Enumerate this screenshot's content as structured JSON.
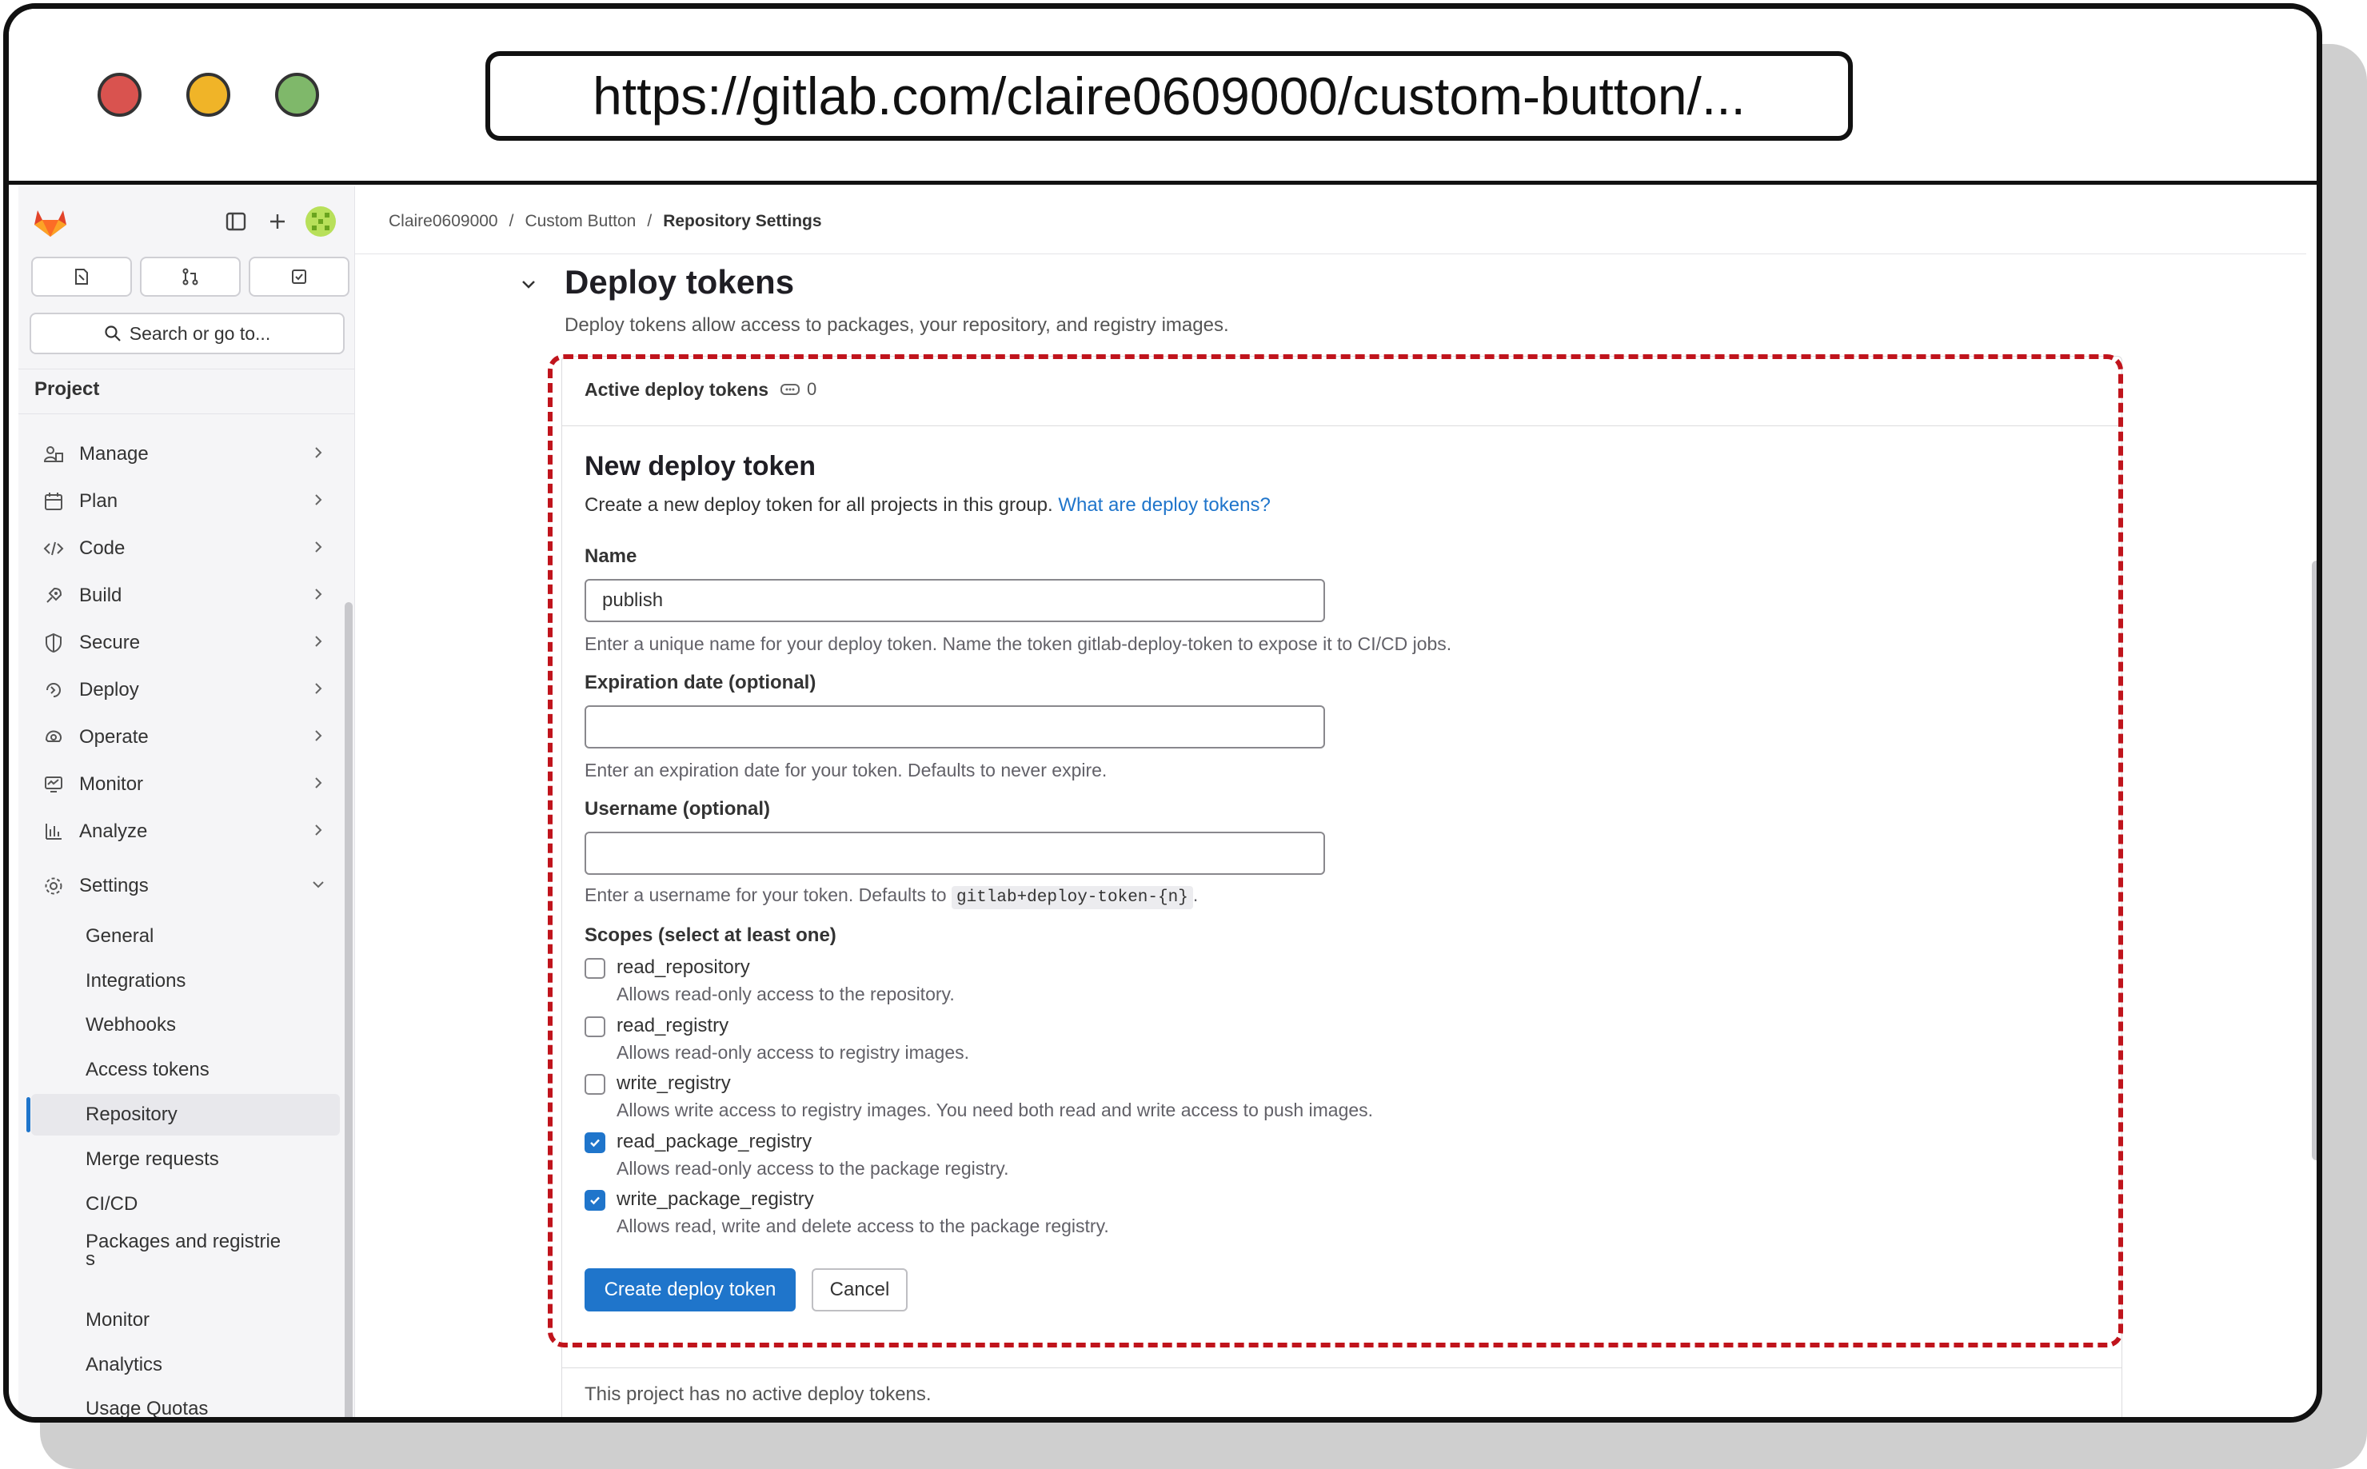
{
  "browser": {
    "url": "https://gitlab.com/claire0609000/custom-button/...",
    "dots": [
      "#d9534f",
      "#f0b428",
      "#7fb86a"
    ]
  },
  "sidebar": {
    "search_label": "Search or go to...",
    "section_label": "Project",
    "nav": [
      {
        "label": "Manage",
        "icon": "manage-icon"
      },
      {
        "label": "Plan",
        "icon": "plan-icon"
      },
      {
        "label": "Code",
        "icon": "code-icon"
      },
      {
        "label": "Build",
        "icon": "build-icon"
      },
      {
        "label": "Secure",
        "icon": "shield-icon"
      },
      {
        "label": "Deploy",
        "icon": "deploy-icon"
      },
      {
        "label": "Operate",
        "icon": "operate-icon"
      },
      {
        "label": "Monitor",
        "icon": "monitor-icon"
      },
      {
        "label": "Analyze",
        "icon": "analyze-icon"
      },
      {
        "label": "Settings",
        "icon": "gear-icon"
      }
    ],
    "settings_sub": [
      {
        "label": "General"
      },
      {
        "label": "Integrations"
      },
      {
        "label": "Webhooks"
      },
      {
        "label": "Access tokens"
      },
      {
        "label": "Repository",
        "active": true
      },
      {
        "label": "Merge requests"
      },
      {
        "label": "CI/CD"
      },
      {
        "label": "Packages and registrie\ns"
      },
      {
        "label": "Monitor"
      },
      {
        "label": "Analytics"
      },
      {
        "label": "Usage Quotas"
      }
    ]
  },
  "breadcrumb": {
    "items": [
      "Claire0609000",
      "Custom Button",
      "Repository Settings"
    ],
    "separator": "/"
  },
  "section": {
    "title": "Deploy tokens",
    "description": "Deploy tokens allow access to packages, your repository, and registry images."
  },
  "card": {
    "header_label": "Active deploy tokens",
    "count": "0",
    "form_title": "New deploy token",
    "form_desc": "Create a new deploy token for all projects in this group.",
    "form_link": "What are deploy tokens?",
    "name_label": "Name",
    "name_value": "publish",
    "name_help": "Enter a unique name for your deploy token. Name the token gitlab-deploy-token to expose it to CI/CD jobs.",
    "expiration_label": "Expiration date (optional)",
    "expiration_value": "",
    "expiration_help": "Enter an expiration date for your token. Defaults to never expire.",
    "username_label": "Username (optional)",
    "username_value": "",
    "username_help_prefix": "Enter a username for your token. Defaults to",
    "username_help_code": "gitlab+deploy-token-{n}",
    "username_help_suffix": ".",
    "scopes_label": "Scopes (select at least one)",
    "scopes": [
      {
        "name": "read_repository",
        "desc": "Allows read-only access to the repository.",
        "checked": false
      },
      {
        "name": "read_registry",
        "desc": "Allows read-only access to registry images.",
        "checked": false
      },
      {
        "name": "write_registry",
        "desc": "Allows write access to registry images. You need both read and write access to push images.",
        "checked": false
      },
      {
        "name": "read_package_registry",
        "desc": "Allows read-only access to the package registry.",
        "checked": true
      },
      {
        "name": "write_package_registry",
        "desc": "Allows read, write and delete access to the package registry.",
        "checked": true
      }
    ],
    "create_label": "Create deploy token",
    "cancel_label": "Cancel",
    "footer_text": "This project has no active deploy tokens."
  },
  "colors": {
    "accent": "#1f75cb",
    "highlight_border": "#c0141c"
  }
}
